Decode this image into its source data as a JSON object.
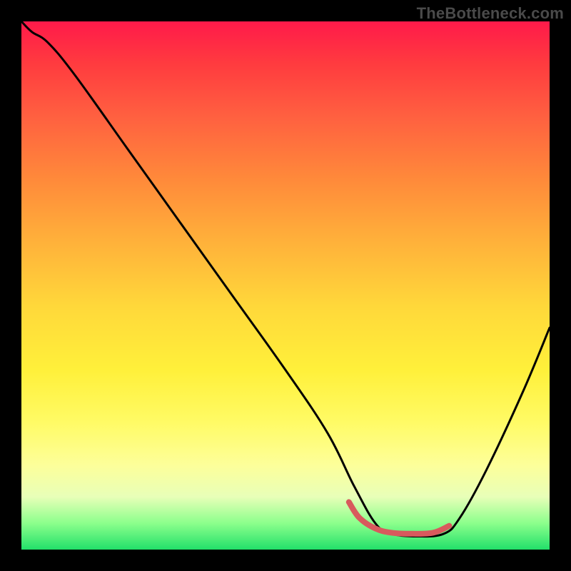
{
  "watermark": "TheBottleneck.com",
  "colors": {
    "background": "#000000",
    "curve": "#000000",
    "accent_band": "#d85a5d",
    "gradient_top": "#ff1a4a",
    "gradient_bottom": "#22e06a"
  },
  "chart_data": {
    "type": "line",
    "title": "",
    "xlabel": "",
    "ylabel": "",
    "xlim": [
      0,
      100
    ],
    "ylim": [
      0,
      100
    ],
    "grid": false,
    "legend": false,
    "notes": "Canvas uses a full-area vertical gradient (red→orange→yellow→green). A black curve descends steeply from upper-left, reaches a flat minimum around x≈67–80 at y≈3, then rises toward the right edge. A short salmon segment overlays the up-left portion of the V near the trough.",
    "series": [
      {
        "name": "bottleneck-curve",
        "x": [
          0,
          2,
          5,
          10,
          20,
          30,
          40,
          50,
          58,
          63,
          67,
          70,
          75,
          80,
          83,
          88,
          95,
          100
        ],
        "y": [
          100,
          98,
          96,
          90,
          76,
          62,
          48,
          34,
          22,
          12,
          5,
          3,
          2.5,
          3,
          6,
          15,
          30,
          42
        ]
      }
    ],
    "accent_segment": {
      "name": "trough-highlight",
      "x": [
        62,
        64,
        67,
        70,
        74,
        78,
        81
      ],
      "y": [
        9,
        6,
        4,
        3.2,
        3,
        3.2,
        4.5
      ]
    }
  }
}
